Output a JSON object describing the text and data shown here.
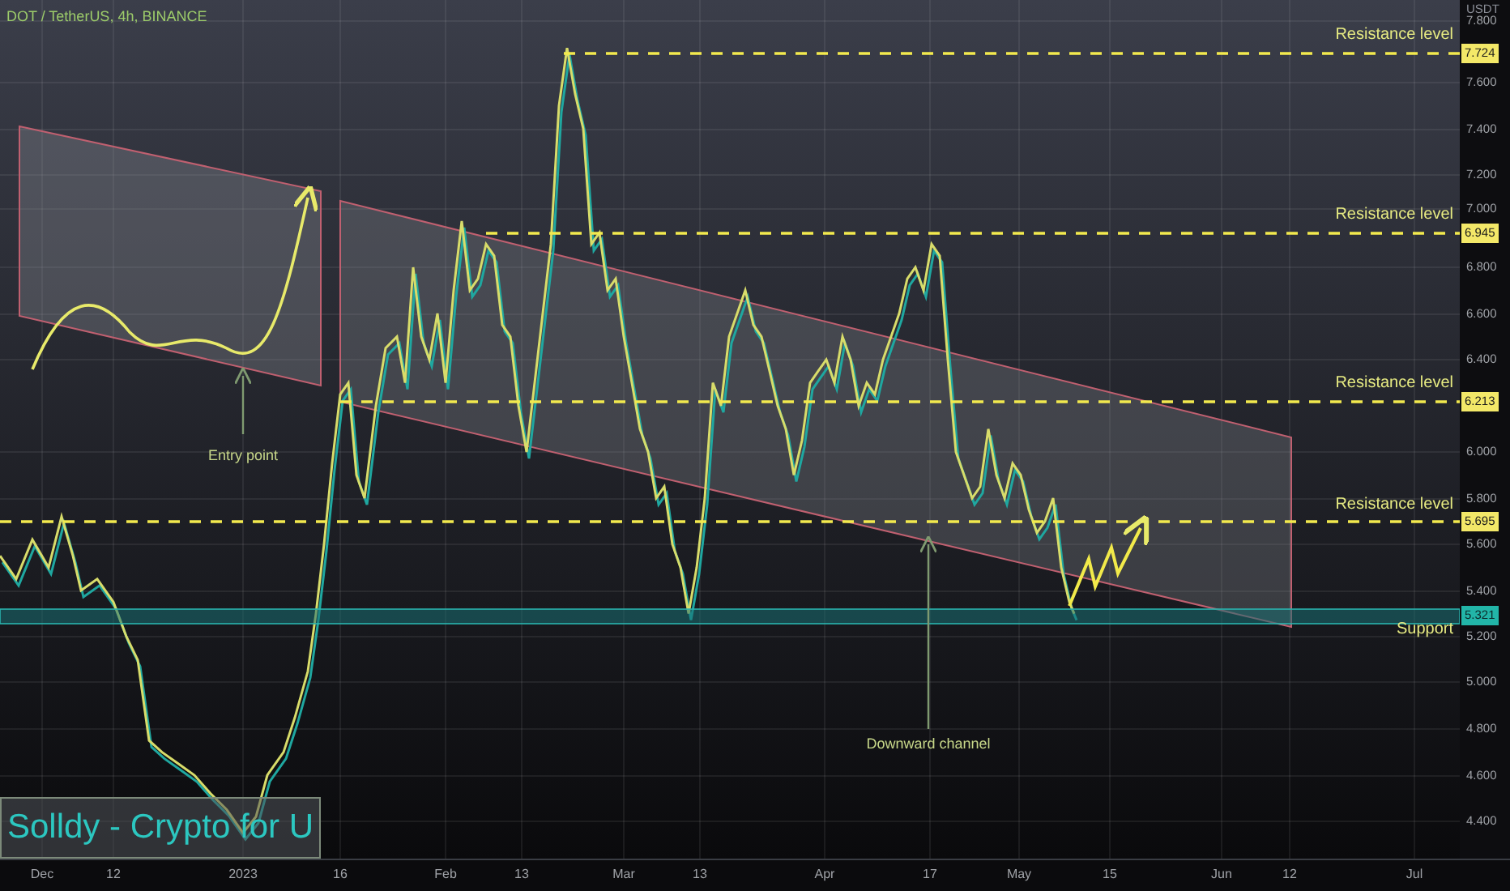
{
  "title": "DOT / TetherUS, 4h, BINANCE",
  "currency": "USDT",
  "price_axis": [
    "7.800",
    "7.600",
    "7.400",
    "7.200",
    "7.000",
    "6.800",
    "6.600",
    "6.400",
    "6.000",
    "5.800",
    "5.600",
    "5.400",
    "5.200",
    "5.000",
    "4.800",
    "4.600",
    "4.400"
  ],
  "time_axis": [
    "Dec",
    "12",
    "2023",
    "16",
    "Feb",
    "13",
    "Mar",
    "13",
    "Apr",
    "17",
    "May",
    "15",
    "Jun",
    "12",
    "Jul"
  ],
  "levels": [
    {
      "kind": "resistance",
      "label": "Resistance level",
      "price": "7.724"
    },
    {
      "kind": "resistance",
      "label": "Resistance level",
      "price": "6.945"
    },
    {
      "kind": "resistance",
      "label": "Resistance level",
      "price": "6.213"
    },
    {
      "kind": "resistance",
      "label": "Resistance level",
      "price": "5.695"
    },
    {
      "kind": "support",
      "label": "Support",
      "price": "5.321"
    }
  ],
  "annotations": [
    {
      "label": "Entry point"
    },
    {
      "label": "Downward channel"
    }
  ],
  "author_tag": "Solldy - Crypto for U"
}
